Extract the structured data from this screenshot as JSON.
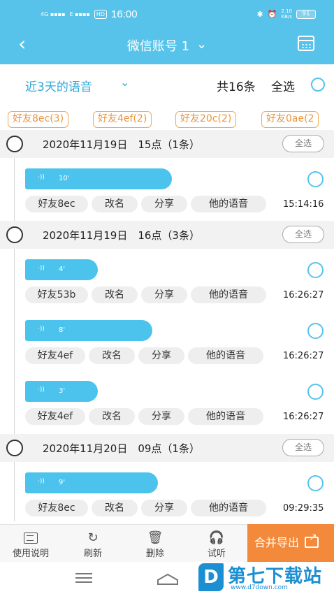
{
  "status_bar": {
    "network": "4G",
    "signal_a": "4G ▪▪▪▪",
    "signal_b": "E ▪▪▪▪",
    "hd": "HD",
    "time": "16:00",
    "speed_value": "2.10",
    "speed_unit": "KB/s",
    "battery": "91"
  },
  "header": {
    "title": "微信账号 1",
    "colors": {
      "bar": "#57c3ea",
      "accent": "#2fa9d8",
      "orange": "#f38a3b"
    }
  },
  "filter": {
    "range_label": "近3天的语音",
    "count_label": "共16条",
    "select_all_label": "全选"
  },
  "friend_chips": [
    "好友8ec(3)",
    "好友4ef(2)",
    "好友20c(2)",
    "好友0ae(2"
  ],
  "groups": [
    {
      "date_label": "2020年11月19日　15点（1条）",
      "select_label": "全选",
      "items": [
        {
          "duration": "10'",
          "friend": "好友8ec",
          "rename": "改名",
          "share": "分享",
          "theirs": "他的语音",
          "time": "15:14:16"
        }
      ]
    },
    {
      "date_label": "2020年11月19日　16点（3条）",
      "select_label": "全选",
      "items": [
        {
          "duration": "4'",
          "friend": "好友53b",
          "rename": "改名",
          "share": "分享",
          "theirs": "他的语音",
          "time": "16:26:27"
        },
        {
          "duration": "8'",
          "friend": "好友4ef",
          "rename": "改名",
          "share": "分享",
          "theirs": "他的语音",
          "time": "16:26:27"
        },
        {
          "duration": "3'",
          "friend": "好友4ef",
          "rename": "改名",
          "share": "分享",
          "theirs": "他的语音",
          "time": "16:26:27"
        }
      ]
    },
    {
      "date_label": "2020年11月20日　09点（1条）",
      "select_label": "全选",
      "items": [
        {
          "duration": "9'",
          "friend": "好友8ec",
          "rename": "改名",
          "share": "分享",
          "theirs": "他的语音",
          "time": "09:29:35"
        }
      ]
    }
  ],
  "toolbar": {
    "help": "使用说明",
    "refresh": "刷新",
    "delete": "删除",
    "listen": "试听",
    "merge_export": "合并导出"
  },
  "watermark": {
    "name": "第七下载站",
    "url": "www.d7down.com"
  }
}
